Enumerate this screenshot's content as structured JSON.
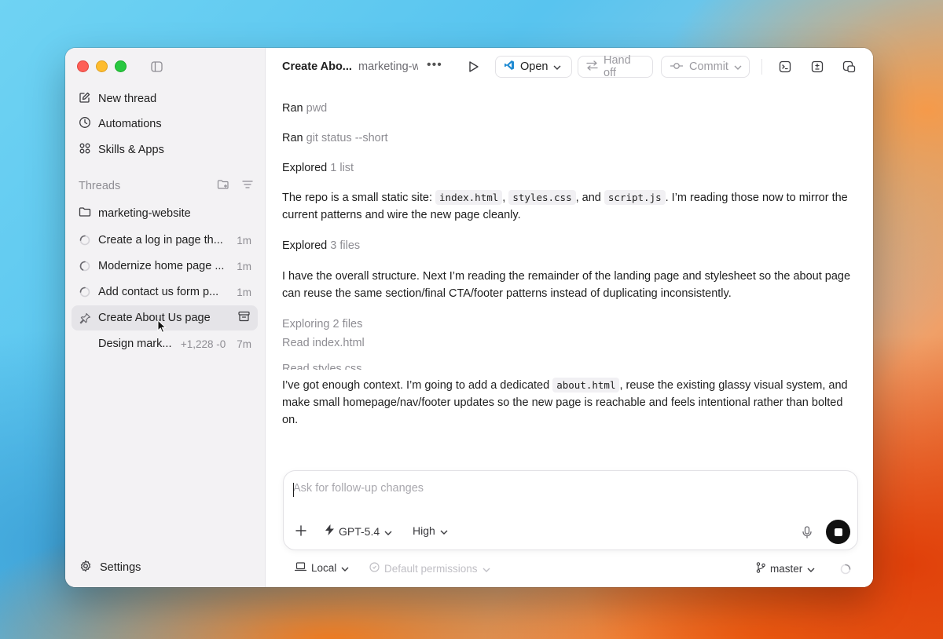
{
  "window": {
    "sidebar": {
      "nav": [
        {
          "label": "New thread",
          "icon": "compose-icon"
        },
        {
          "label": "Automations",
          "icon": "clock-icon"
        },
        {
          "label": "Skills & Apps",
          "icon": "grid-icon"
        }
      ],
      "threads_header": "Threads",
      "project": "marketing-website",
      "threads": [
        {
          "label": "Create a log in page th...",
          "time": "1m",
          "icon": "spinner-icon"
        },
        {
          "label": "Modernize home page ...",
          "time": "1m",
          "icon": "spinner-icon"
        },
        {
          "label": "Add contact us form p...",
          "time": "1m",
          "icon": "spinner-icon"
        },
        {
          "label": "Create About Us page",
          "time": "",
          "icon": "pin-icon",
          "active": true
        },
        {
          "label": "Design mark...",
          "time": "7m",
          "diff": "+1,228 -0"
        }
      ],
      "settings_label": "Settings"
    },
    "topbar": {
      "title": "Create Abo...",
      "project": "marketing-website",
      "open_label": "Open",
      "handoff_label": "Hand off",
      "commit_label": "Commit"
    },
    "transcript": {
      "ran1_prefix": "Ran",
      "ran1_cmd": "pwd",
      "ran2_prefix": "Ran",
      "ran2_cmd": "git status --short",
      "explored1_prefix": "Explored",
      "explored1_detail": "1 list",
      "para1_a": "The repo is a small static site: ",
      "para1_code1": "index.html",
      "para1_b": ", ",
      "para1_code2": "styles.css",
      "para1_c": ", and ",
      "para1_code3": "script.js",
      "para1_d": ". I’m reading those now to mirror the current patterns and wire the new page cleanly.",
      "explored2_prefix": "Explored",
      "explored2_detail": "3 files",
      "para2": "I have the overall structure. Next I’m reading the remainder of the landing page and stylesheet so the about page can reuse the same section/final CTA/footer patterns instead of duplicating inconsistently.",
      "exploring_label": "Exploring 2 files",
      "read1": "Read index.html",
      "read2": "Read styles.css",
      "para3_a": "I’ve got enough context. I’m going to add a dedicated ",
      "para3_code": "about.html",
      "para3_b": ", reuse the existing glassy visual system, and make small homepage/nav/footer updates so the new page is reachable and feels intentional rather than bolted on."
    },
    "composer": {
      "placeholder": "Ask for follow-up changes",
      "model": "GPT-5.4",
      "effort": "High"
    },
    "footer": {
      "env": "Local",
      "permissions": "Default permissions",
      "branch": "master"
    }
  },
  "colors": {
    "accent_vscode": "#1f8ad2",
    "stop_button": "#111111"
  }
}
